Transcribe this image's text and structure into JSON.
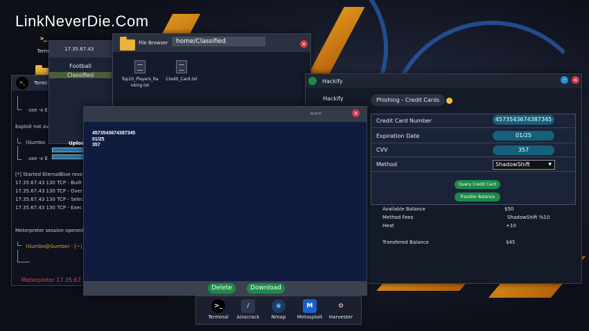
{
  "watermark": "LinkNeverDie.Com",
  "desktop": {
    "terminal_label": "Termi",
    "folder_label": ""
  },
  "terminal": {
    "title": "Termi",
    "icon": ">_",
    "lines": {
      "l1": "use -x E",
      "l2": "Exploit not ava",
      "l3": "(Gumbo",
      "l4": "use -x E",
      "l5": "[*] Started EternalBlue revers",
      "l6": "17.35.67.43 130 TCP  - Built",
      "l7": "17.35.67.43 130 TCP  - Over",
      "l8": "17.35.67.43 130 TCP  - Selec",
      "l9": "17.35.67.43 130 TCP  - Exec",
      "l10": "Meterpreter session opened (",
      "l11": "(Gumbo@Gumbo) - [~]",
      "l12": "Meterpreter 17.35.67."
    }
  },
  "ip_panel": {
    "ip": "17.35.67.43",
    "items": [
      "Football",
      "Classified"
    ],
    "upload_label": "Uploa"
  },
  "file_browser": {
    "title": "File Browser",
    "path": "home/Classified",
    "files": [
      {
        "name_line1": "Top10_Players_Ra",
        "name_line2": "nking.txt"
      },
      {
        "name_line1": "Credit_Card.txt",
        "name_line2": ""
      }
    ]
  },
  "hackify": {
    "title": "Hackify",
    "sidebar_item": "Hackify",
    "tab": "Phishing - Credit Cards",
    "form": {
      "card_number_label": "Credit Card Number",
      "card_number": "4573543674387345",
      "expiration_label": "Expiration Date",
      "expiration": "01/25",
      "cvv_label": "CVV",
      "cvv": "357",
      "method_label": "Method",
      "method": "ShadowShift",
      "query_button": "Query Credit Card",
      "transfer_button": "Transfer Balance"
    },
    "stats": {
      "available_label": "Available Balance",
      "available": "$50",
      "fees_label": "Method Fees",
      "fees": "ShadowShift %10",
      "heat_label": "Heat",
      "heat": "+10",
      "transfered_label": "Transfered Balance",
      "transfered": "$45"
    }
  },
  "viewer": {
    "title_partial": "ware",
    "lines": [
      "4573543674387345",
      "01/25",
      "357"
    ],
    "delete_button": "Delete",
    "download_button": "Download"
  },
  "taskbar": {
    "items": [
      {
        "label": "Terminal",
        "icon": ">_"
      },
      {
        "label": "Airocrack",
        "icon": "/"
      },
      {
        "label": "Nmap",
        "icon": "◉"
      },
      {
        "label": "Metasploit",
        "icon": "M"
      },
      {
        "label": "Harvester",
        "icon": "✿"
      }
    ]
  },
  "colors": {
    "accent_green": "#1e8a4a",
    "close_red": "#d23a48",
    "pill_teal": "#15607a",
    "viewer_blue": "#0f1c3e"
  }
}
